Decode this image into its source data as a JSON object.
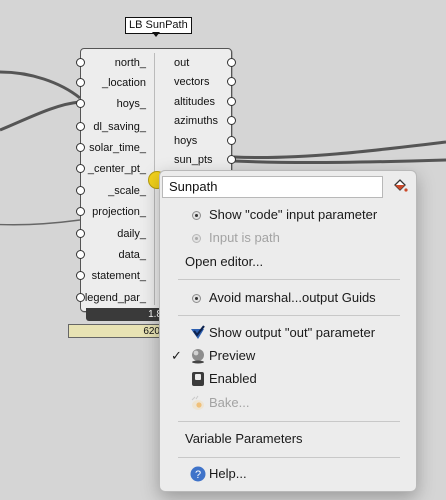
{
  "component": {
    "title": "LB SunPath",
    "inputs": [
      "north_",
      "_location",
      "hoys_",
      "dl_saving_",
      "solar_time_",
      "_center_pt_",
      "_scale_",
      "projection_",
      "daily_",
      "data_",
      "statement_",
      "legend_par_"
    ],
    "outputs": [
      "out",
      "vectors",
      "altitudes",
      "azimuths",
      "hoys",
      "sun_pts"
    ],
    "version": "1.8",
    "count": "620"
  },
  "context_menu": {
    "name_value": "Sunpath",
    "items": {
      "show_code_input": "Show \"code\" input parameter",
      "input_is_path": "Input is path",
      "open_editor": "Open editor...",
      "avoid_marshal": "Avoid marshal...output Guids",
      "show_output": "Show output \"out\" parameter",
      "preview": "Preview",
      "enabled": "Enabled",
      "bake": "Bake...",
      "variable_parameters": "Variable Parameters",
      "help": "Help..."
    },
    "preview_check": "✓"
  },
  "icons": [
    "paint-bucket-icon",
    "radio-dot-icon",
    "checkmark-icon",
    "sphere-icon",
    "switch-icon",
    "bake-egg-icon",
    "help-icon",
    "sun-icon"
  ],
  "colors": {
    "canvas": "#d5d5d5",
    "menu": "#ececec",
    "footer_bar": "#e8e3b4",
    "sun": "#f3d21b",
    "help": "#3f73c9"
  }
}
